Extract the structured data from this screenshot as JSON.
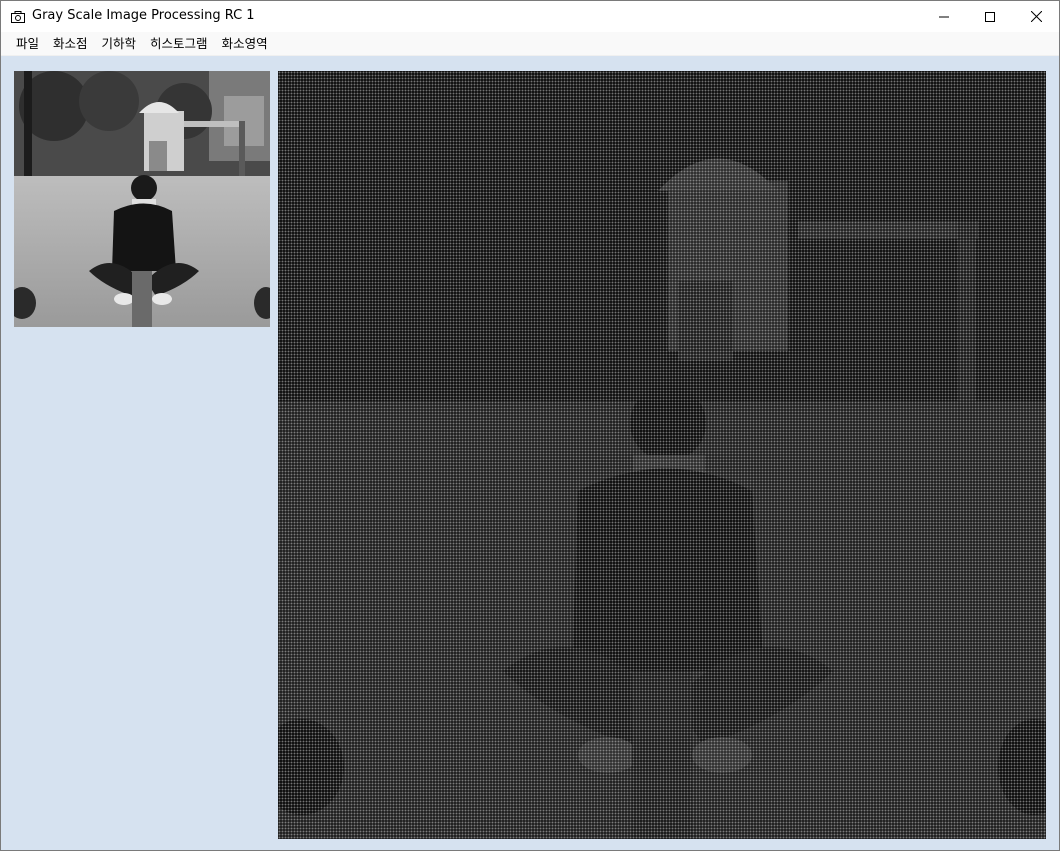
{
  "window": {
    "title": "Gray Scale Image Processing RC 1",
    "icon": "camera-icon",
    "controls": [
      "minimize-icon",
      "maximize-icon",
      "close-icon"
    ]
  },
  "menu": {
    "items": [
      {
        "label": "파일"
      },
      {
        "label": "화소점"
      },
      {
        "label": "기하학"
      },
      {
        "label": "히스토그램"
      },
      {
        "label": "화소영역"
      }
    ]
  },
  "colors": {
    "client_background": "#d6e2f0",
    "menubar_background": "#f9f9f9",
    "processed_background": "#1b1b1b"
  },
  "images": {
    "original": {
      "content": "grayscale photo of person sitting on playground seesaw"
    },
    "processed": {
      "content": "dithered dark rendering of the same photo"
    }
  }
}
